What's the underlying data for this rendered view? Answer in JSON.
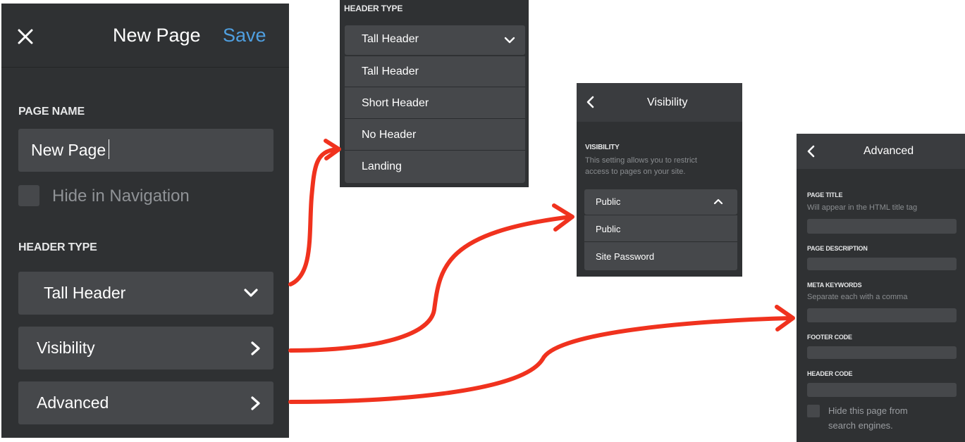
{
  "main_panel": {
    "title": "New Page",
    "save_label": "Save",
    "page_name_label": "PAGE NAME",
    "page_name_value": "New Page",
    "hide_nav_label": "Hide in Navigation",
    "header_type_label": "HEADER TYPE",
    "header_type_value": "Tall Header",
    "visibility_label": "Visibility",
    "advanced_label": "Advanced"
  },
  "header_dropdown": {
    "label": "HEADER TYPE",
    "selected": "Tall Header",
    "options": [
      "Tall Header",
      "Short Header",
      "No Header",
      "Landing"
    ]
  },
  "visibility_panel": {
    "title": "Visibility",
    "label": "VISIBILITY",
    "hint_line1": "This setting allows you to restrict",
    "hint_line2": "access to pages on your site.",
    "selected": "Public",
    "options": [
      "Public",
      "Site Password"
    ]
  },
  "advanced_panel": {
    "title": "Advanced",
    "page_title_label": "PAGE TITLE",
    "page_title_hint": "Will appear in the HTML title tag",
    "page_description_label": "PAGE DESCRIPTION",
    "meta_keywords_label": "META KEYWORDS",
    "meta_keywords_hint": "Separate each with a comma",
    "footer_code_label": "FOOTER CODE",
    "header_code_label": "HEADER CODE",
    "hide_search_line1": "Hide this page from",
    "hide_search_line2": "search engines."
  },
  "colors": {
    "panel_bg": "#2f3133",
    "field_bg": "#46484b",
    "accent_blue": "#4f9fe0",
    "arrow_red": "#f0321e"
  }
}
